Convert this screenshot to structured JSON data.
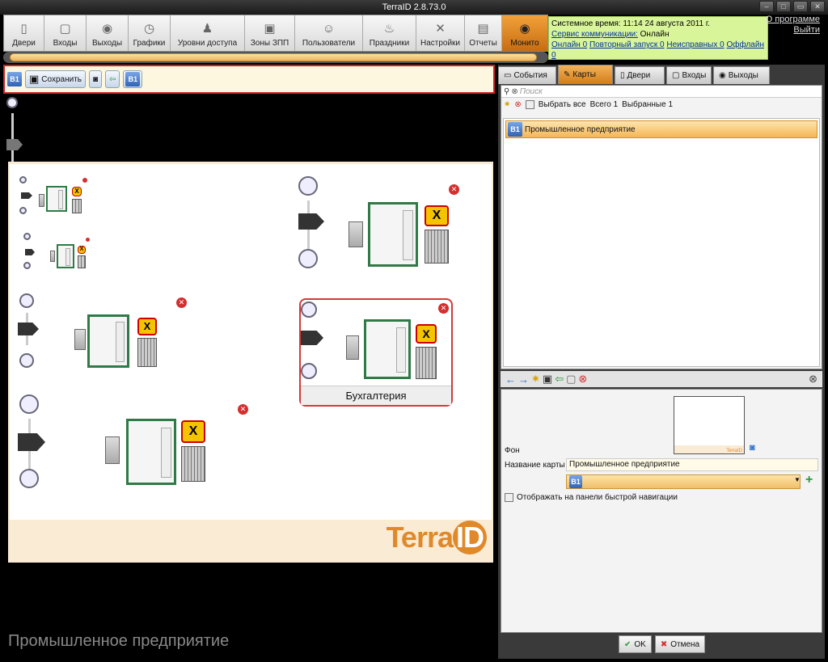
{
  "window": {
    "title": "TerraID 2.8.73.0"
  },
  "toolbar": {
    "items": [
      {
        "label": "Двери",
        "icon": "door-icon"
      },
      {
        "label": "Входы",
        "icon": "entrance-icon"
      },
      {
        "label": "Выходы",
        "icon": "exit-icon"
      },
      {
        "label": "Графики",
        "icon": "clock-icon"
      },
      {
        "label": "Уровни доступа",
        "icon": "access-levels-icon"
      },
      {
        "label": "Зоны ЗПП",
        "icon": "zones-icon"
      },
      {
        "label": "Пользователи",
        "icon": "users-icon"
      },
      {
        "label": "Праздники",
        "icon": "holidays-icon"
      },
      {
        "label": "Настройки",
        "icon": "settings-icon"
      },
      {
        "label": "Отчеты",
        "icon": "reports-icon"
      },
      {
        "label": "Монито",
        "icon": "eye-icon"
      }
    ]
  },
  "status": {
    "system_time_label": "Системное время:",
    "system_time_value": "11:14 24 августа 2011 г.",
    "service_label": "Сервис коммуникации:",
    "service_value": "Онлайн",
    "online": "Онлайн 0",
    "repeat": "Повторный запуск 0",
    "faulty": "Неисправных 0",
    "offline": "Оффлайн 0"
  },
  "top_links": {
    "about": "О программе",
    "exit": "Выйти"
  },
  "editor": {
    "save_label": "Сохранить",
    "b1": "B1",
    "map_caption": "Промышленное предприятие",
    "zone_label": "Бухгалтерия",
    "xsign": "X",
    "logo_terra": "Terra",
    "logo_id": "ID"
  },
  "tabs": [
    {
      "label": "События",
      "icon": "events-icon"
    },
    {
      "label": "Карты",
      "icon": "maps-icon"
    },
    {
      "label": "Двери",
      "icon": "door-icon"
    },
    {
      "label": "Входы",
      "icon": "entrance-icon"
    },
    {
      "label": "Выходы",
      "icon": "exit-icon"
    }
  ],
  "list": {
    "search_placeholder": "Поиск",
    "select_all": "Выбрать все",
    "total": "Всего 1",
    "selected": "Выбранные 1",
    "items": [
      {
        "badge": "B1",
        "label": "Промышленное предприятие"
      }
    ]
  },
  "props": {
    "background_label": "Фон",
    "map_name_label": "Название карты",
    "map_name_value": "Промышленное предприятие",
    "combo_badge": "B1",
    "quick_nav_label": "Отображать на панели быстрой навигации",
    "thumb_logo": "TerraID"
  },
  "buttons": {
    "ok": "OK",
    "cancel": "Отмена"
  }
}
